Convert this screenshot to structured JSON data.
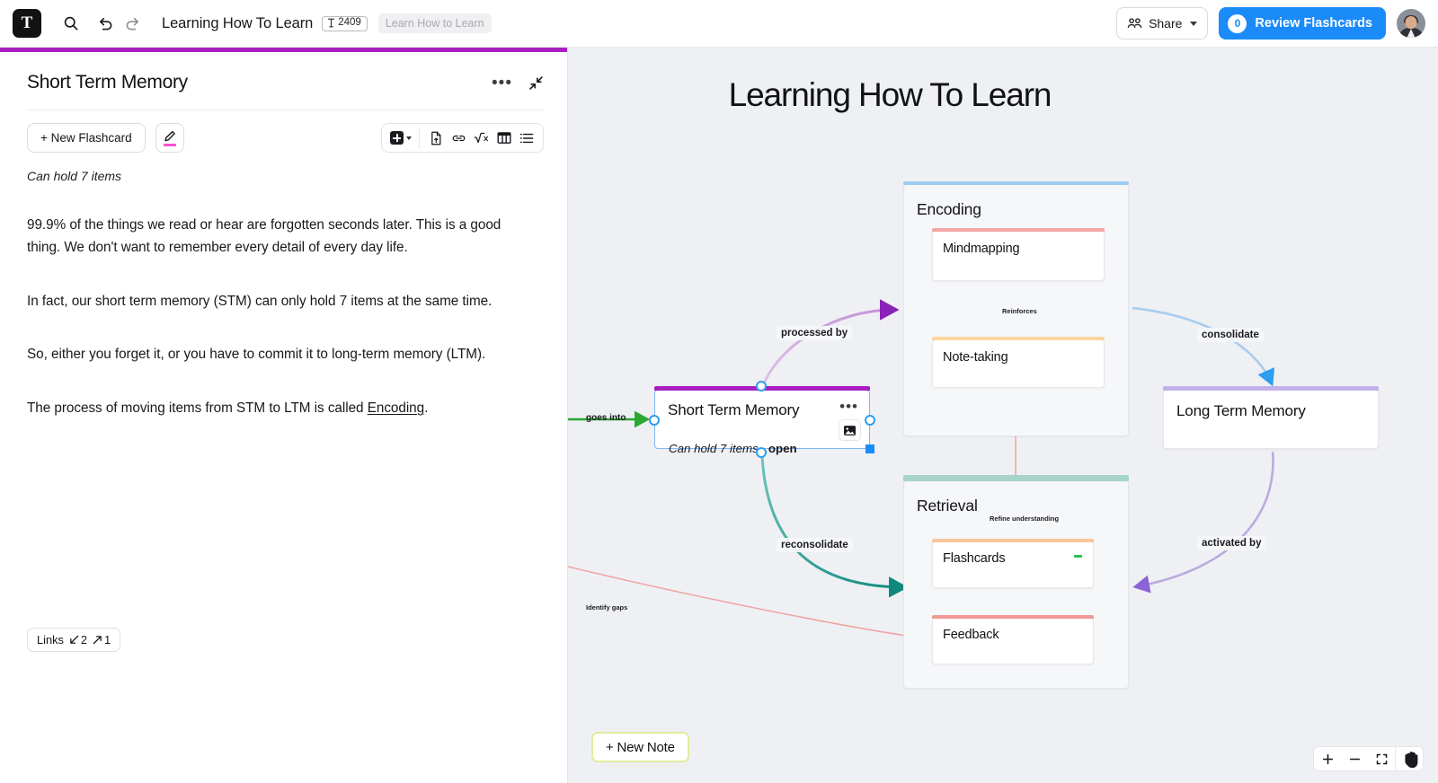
{
  "app": {
    "logo_letter": "T",
    "doc_title": "Learning How To Learn",
    "word_count_badge": "2409",
    "breadcrumb": "Learn How to Learn",
    "share_label": "Share",
    "review_label": "Review Flashcards",
    "review_count": "0",
    "icons": {
      "search": "search-icon",
      "undo": "undo-icon",
      "redo": "redo-icon"
    }
  },
  "editor": {
    "accent_color": "#a81fc0",
    "title": "Short Term Memory",
    "new_flashcard_label": "+ New Flashcard",
    "subtitle": "Can hold 7 items",
    "paragraphs": [
      "99.9% of the things we read or hear are forgotten seconds later. This is a good thing. We don't want to remember every detail of every day life.",
      "In fact, our short term memory (STM) can only hold 7 items at the same time.",
      "So, either you forget it, or you have to commit it to long-term memory (LTM)."
    ],
    "last_paragraph": {
      "before": "The process of moving items from STM to LTM is called ",
      "link": "Encoding",
      "after": "."
    },
    "links_chip": {
      "label": "Links",
      "incoming": "2",
      "outgoing": "1"
    },
    "toolbar_icons": [
      "insert-block-icon",
      "file-upload-icon",
      "link-icon",
      "math-icon",
      "table-icon",
      "list-icon"
    ]
  },
  "canvas": {
    "title": "Learning How To Learn",
    "background": "#eff0f4",
    "new_note_label": "+ New Note",
    "zoom_controls": [
      "zoom-in",
      "zoom-out",
      "fit-screen",
      "pan-hand"
    ],
    "nodes": [
      {
        "id": "encoding",
        "label": "Encoding",
        "accent": "#9fcbf0",
        "type": "group"
      },
      {
        "id": "mindmapping",
        "label": "Mindmapping",
        "accent": "#f3a7a2",
        "type": "card"
      },
      {
        "id": "note-taking",
        "label": "Note-taking",
        "accent": "#fbd6a0",
        "type": "card"
      },
      {
        "id": "short-term-memory",
        "label": "Short Term Memory",
        "accent": "#a81fc0",
        "type": "card",
        "subtitle_italic": "Can hold 7 items...",
        "subtitle_bold": "open",
        "selected": true
      },
      {
        "id": "long-term-memory",
        "label": "Long Term Memory",
        "accent": "#c3b2e8",
        "type": "card"
      },
      {
        "id": "retrieval",
        "label": "Retrieval",
        "accent": "#a6d4c6",
        "type": "group"
      },
      {
        "id": "flashcards",
        "label": "Flashcards",
        "accent": "#fac69a",
        "type": "card"
      },
      {
        "id": "feedback",
        "label": "Feedback",
        "accent": "#f09a95",
        "type": "card"
      }
    ],
    "edge_labels": [
      {
        "id": "goes-into",
        "text": "goes into",
        "color": "#2aa832"
      },
      {
        "id": "processed-by",
        "text": "processed by",
        "color": "#cda3d8"
      },
      {
        "id": "consolidate",
        "text": "consolidate",
        "color": "#a8ccee"
      },
      {
        "id": "activated-by",
        "text": "activated by",
        "color": "#bcaade"
      },
      {
        "id": "reconsolidate",
        "text": "reconsolidate",
        "color": "#0e8a7d"
      },
      {
        "id": "reinforces",
        "text": "Reinforces",
        "color": "#f3a48c"
      },
      {
        "id": "refine-understanding",
        "text": "Refine understanding",
        "color": "#f0a3a0"
      },
      {
        "id": "identify-gaps",
        "text": "Identify gaps",
        "color": "#f0a3a0"
      }
    ]
  }
}
